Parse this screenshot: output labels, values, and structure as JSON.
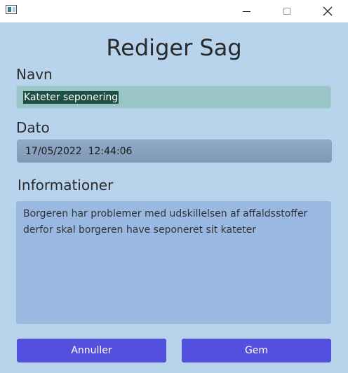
{
  "window": {
    "title_icon": "app-window-icon",
    "controls": [
      "minimize-icon",
      "maximize-icon",
      "close-icon"
    ]
  },
  "form": {
    "title": "Rediger Sag",
    "name_label": "Navn",
    "name_value": "Kateter seponering",
    "date_label": "Dato",
    "date_value": "17/05/2022  12:44:06",
    "info_label": "Informationer",
    "info_value": "Borgeren har problemer med udskillelsen af affaldsstoffer derfor skal borgeren have seponeret sit kateter"
  },
  "buttons": {
    "cancel_label": "Annuller",
    "save_label": "Gem"
  },
  "colors": {
    "background": "#b8d3ec",
    "accent_button": "#5350de",
    "name_field": "#99c5c8",
    "info_field": "#99b9e2"
  }
}
